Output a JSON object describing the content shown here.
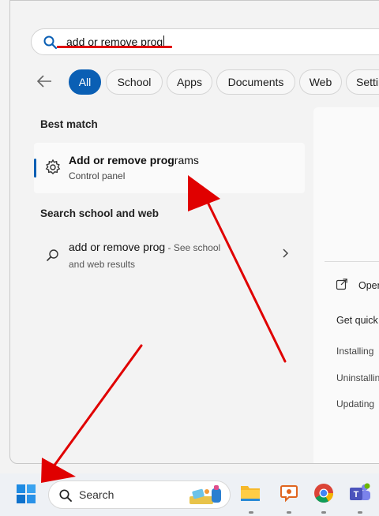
{
  "search": {
    "query": "add or remove prog"
  },
  "filters": [
    "All",
    "School",
    "Apps",
    "Documents",
    "Web",
    "Settings"
  ],
  "best_match": {
    "heading": "Best match",
    "title_bold": "Add or remove prog",
    "title_rest": "rams",
    "subtitle": "Control panel",
    "icon": "gear-icon"
  },
  "web_section": {
    "heading": "Search school and web",
    "query": "add or remove prog",
    "hint": " - See school",
    "line2": "and web results",
    "icon": "search-icon"
  },
  "preview": {
    "open_label": "Open",
    "quick_links_title": "Get quick help from web",
    "quick_links": [
      "Installing",
      "Uninstalling",
      "Updating"
    ]
  },
  "taskbar": {
    "search_placeholder": "Search",
    "apps": [
      "file-explorer-icon",
      "chat-icon",
      "chrome-icon",
      "teams-icon"
    ]
  },
  "colors": {
    "accent": "#0a5fb4",
    "annotation": "#e00000"
  }
}
